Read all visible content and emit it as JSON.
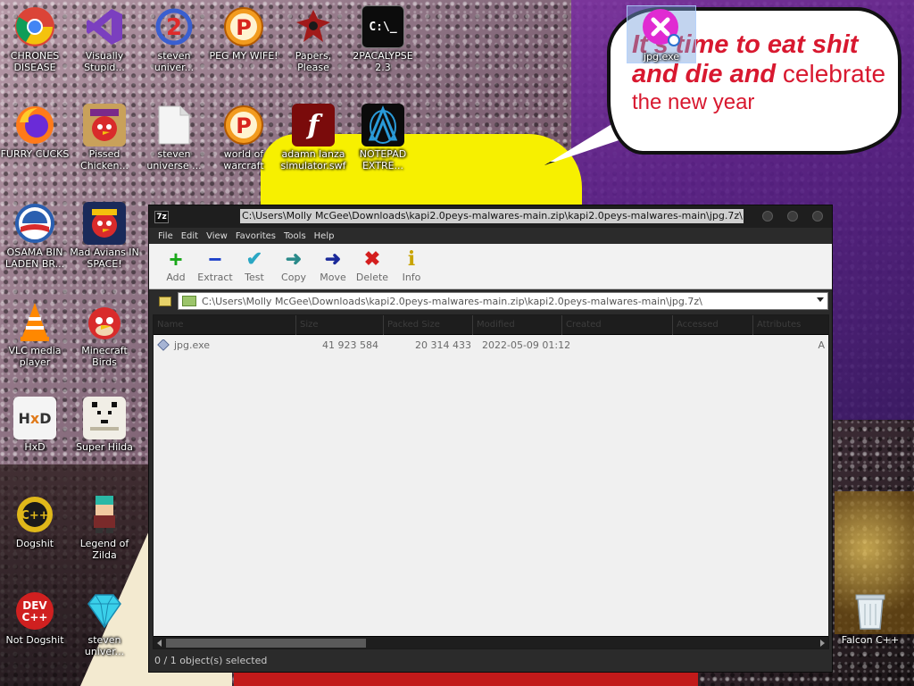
{
  "wallpaper": {
    "bubble_line1": "It's time to eat shit",
    "bubble_line2a": "and die and",
    "bubble_line2b": " celebrate",
    "bubble_line3": "the new year"
  },
  "desktop_icons": [
    {
      "label": "CHRONES DISEASE",
      "icon": "chrome-icon"
    },
    {
      "label": "Visually Stupid...",
      "icon": "visual-studio-icon"
    },
    {
      "label": "steven univer...",
      "icon": "steven-universe-icon"
    },
    {
      "label": "PEG MY WIFE!",
      "icon": "peggle-icon"
    },
    {
      "label": "Papers, Please",
      "icon": "papers-please-icon"
    },
    {
      "label": "2PACALYPSE 2.3",
      "icon": "terminal-icon"
    },
    {
      "label": "jpg.exe",
      "icon": "error-x-icon"
    },
    {
      "label": "FURRY CUCKS",
      "icon": "firefox-icon"
    },
    {
      "label": "Pissed Chicken...",
      "icon": "angry-birds-seasons-icon"
    },
    {
      "label": "steven universe ...",
      "icon": "blank-file-icon"
    },
    {
      "label": "world of warcraft",
      "icon": "peggle-icon"
    },
    {
      "label": "adamn lanza simulator.swf",
      "icon": "flash-icon"
    },
    {
      "label": "NOTEPAD EXTRE...",
      "icon": "notepad-icon"
    },
    {
      "label": "OSAMA BIN LADEN BR...",
      "icon": "obama-logo-icon"
    },
    {
      "label": "Mad Avians IN SPACE!",
      "icon": "angry-birds-space-icon"
    },
    {
      "label": "VLC media player",
      "icon": "vlc-icon"
    },
    {
      "label": "Minecraft Birds",
      "icon": "angry-birds-icon"
    },
    {
      "label": "HxD",
      "icon": "hxd-icon"
    },
    {
      "label": "Super Hilda",
      "icon": "pixel-cat-icon"
    },
    {
      "label": "Dogshit",
      "icon": "cpp-icon"
    },
    {
      "label": "Legend of Zilda",
      "icon": "pixel-character-icon"
    },
    {
      "label": "Not Dogshit",
      "icon": "dev-cpp-icon"
    },
    {
      "label": "steven univer...",
      "icon": "diamond-icon"
    },
    {
      "label": "Falcon C++",
      "icon": "recycle-bin-icon"
    }
  ],
  "window": {
    "app_badge": "7z",
    "title": "C:\\Users\\Molly McGee\\Downloads\\kapi2.0peys-malwares-main.zip\\kapi2.0peys-malwares-main\\jpg.7z\\",
    "menu": [
      "File",
      "Edit",
      "View",
      "Favorites",
      "Tools",
      "Help"
    ],
    "toolbar": [
      {
        "label": "Add",
        "glyph": "+",
        "color": "#1aa81a"
      },
      {
        "label": "Extract",
        "glyph": "−",
        "color": "#1a3fc9"
      },
      {
        "label": "Test",
        "glyph": "✔",
        "color": "#2aa7c4"
      },
      {
        "label": "Copy",
        "glyph": "➜",
        "color": "#2a8a8a"
      },
      {
        "label": "Move",
        "glyph": "➜",
        "color": "#1b2a9a"
      },
      {
        "label": "Delete",
        "glyph": "✖",
        "color": "#d41e1e"
      },
      {
        "label": "Info",
        "glyph": "i",
        "color": "#c9a400"
      }
    ],
    "address": "C:\\Users\\Molly McGee\\Downloads\\kapi2.0peys-malwares-main.zip\\kapi2.0peys-malwares-main\\jpg.7z\\",
    "columns": [
      "Name",
      "Size",
      "Packed Size",
      "Modified",
      "Created",
      "Accessed",
      "Attributes"
    ],
    "files": [
      {
        "name": "jpg.exe",
        "size": "41 923 584",
        "packed": "20 314 433",
        "modified": "2022-05-09 01:12",
        "attr": "A"
      }
    ],
    "status": "0 / 1 object(s) selected"
  }
}
